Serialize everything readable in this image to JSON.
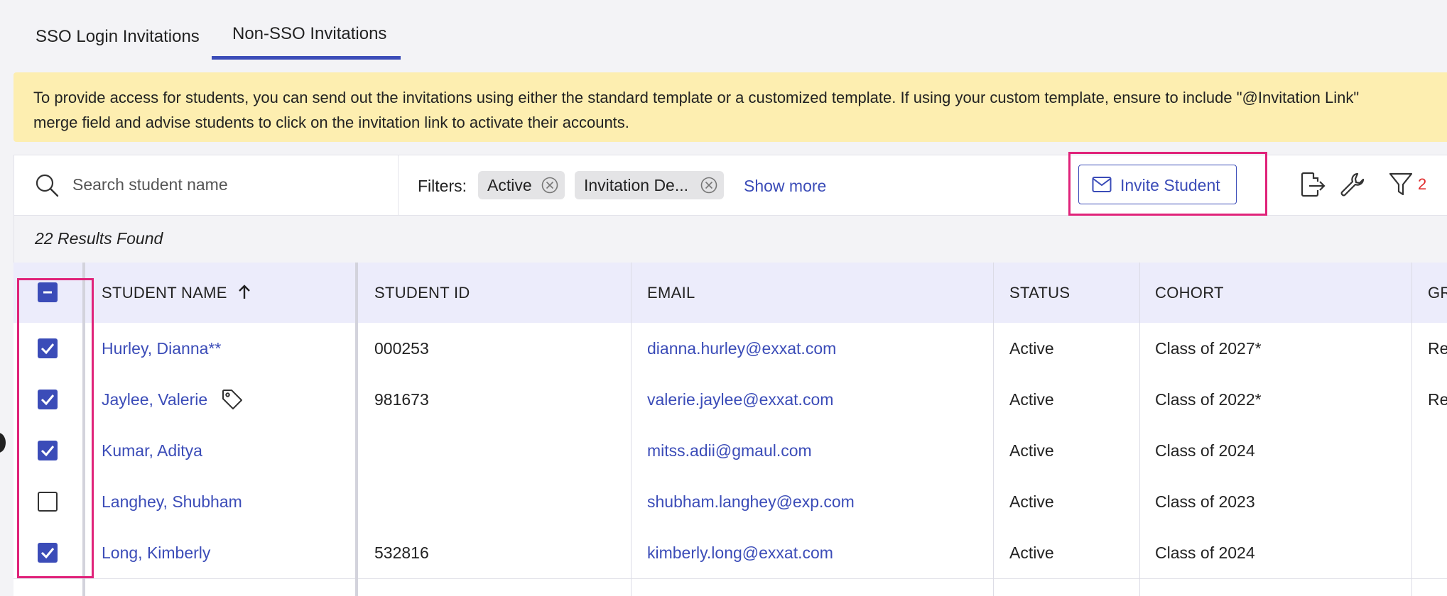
{
  "tabs": [
    {
      "label": "SSO Login Invitations",
      "active": false
    },
    {
      "label": "Non-SSO Invitations",
      "active": true
    }
  ],
  "banner": {
    "line1": "To provide access for students, you can send out the invitations using either the standard template or a customized template. If using your custom template, ensure to include \"@Invitation Link\"",
    "line2": "merge field and advise students to click on the invitation link to activate their accounts."
  },
  "toolbar": {
    "search_placeholder": "Search student name",
    "filters_label": "Filters:",
    "chips": [
      "Active",
      "Invitation De..."
    ],
    "show_more": "Show more",
    "invite_label": "Invite Student",
    "filter_count": "2"
  },
  "results": "22 Results Found",
  "table": {
    "headers": [
      "STUDENT NAME",
      "STUDENT ID",
      "EMAIL",
      "STATUS",
      "COHORT",
      "GR"
    ],
    "rows": [
      {
        "name": "Hurley, Dianna**",
        "id": "000253",
        "email": "dianna.hurley@exxat.com",
        "status": "Active",
        "cohort": "Class of 2027*",
        "gr": "Re",
        "checked": true
      },
      {
        "name": "Jaylee, Valerie",
        "id": "981673",
        "email": "valerie.jaylee@exxat.com",
        "status": "Active",
        "cohort": "Class of 2022*",
        "gr": "Re",
        "checked": true
      },
      {
        "name": "Kumar, Aditya",
        "id": "",
        "email": "mitss.adii@gmaul.com",
        "status": "Active",
        "cohort": "Class of 2024",
        "gr": "",
        "checked": true
      },
      {
        "name": "Langhey, Shubham",
        "id": "",
        "email": "shubham.langhey@exp.com",
        "status": "Active",
        "cohort": "Class of 2023",
        "gr": "",
        "checked": false
      },
      {
        "name": "Long, Kimberly",
        "id": "532816",
        "email": "kimberly.long@exxat.com",
        "status": "Active",
        "cohort": "Class of 2024",
        "gr": "",
        "checked": true
      }
    ]
  },
  "colors": {
    "accent": "#3b4cb8",
    "highlight": "#e0237a",
    "banner": "#fdeeb0",
    "header": "#ececfb"
  }
}
